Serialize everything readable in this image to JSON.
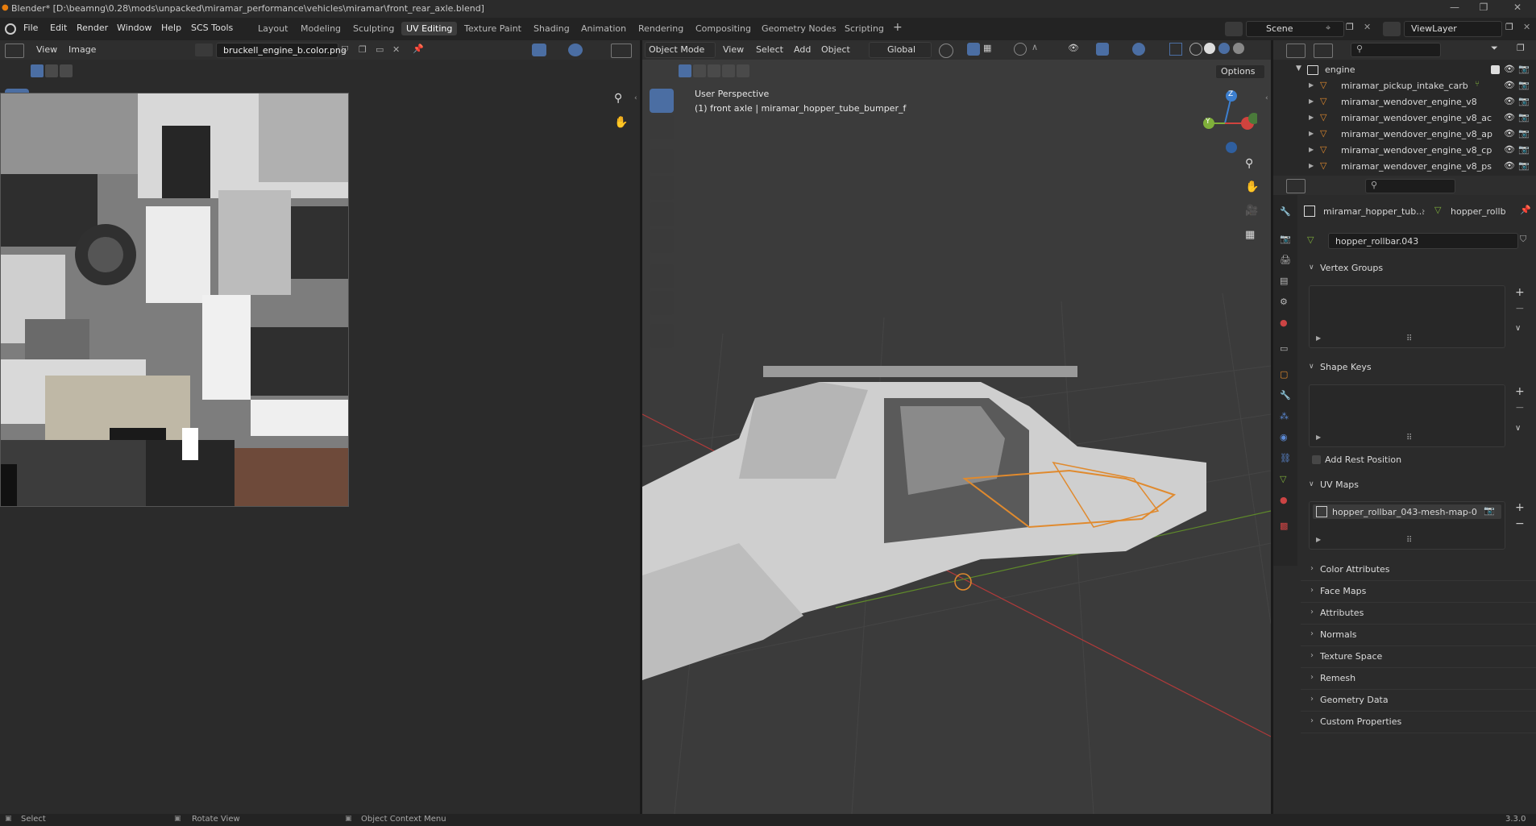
{
  "window": {
    "title": "Blender* [D:\\beamng\\0.28\\mods\\unpacked\\miramar_performance\\vehicles\\miramar\\front_rear_axle.blend]"
  },
  "menu": [
    "File",
    "Edit",
    "Render",
    "Window",
    "Help",
    "SCS Tools"
  ],
  "workspaces": [
    "Layout",
    "Modeling",
    "Sculpting",
    "UV Editing",
    "Texture Paint",
    "Shading",
    "Animation",
    "Rendering",
    "Compositing",
    "Geometry Nodes",
    "Scripting"
  ],
  "active_workspace": "UV Editing",
  "scene": "Scene",
  "view_layer": "ViewLayer",
  "uv_editor": {
    "view_label": "View",
    "image_label": "Image",
    "image_name": "bruckell_engine_b.color.png"
  },
  "viewport": {
    "mode": "Object Mode",
    "menus": [
      "View",
      "Select",
      "Add",
      "Object"
    ],
    "transform_orientation": "Global",
    "options": "Options",
    "overlay_line1": "User Perspective",
    "overlay_line2": "(1) front axle | miramar_hopper_tube_bumper_f",
    "gizmo_axes": {
      "z": "Z",
      "y": "Y"
    }
  },
  "outliner": {
    "collection": "engine",
    "items": [
      "miramar_pickup_intake_carb",
      "miramar_wendover_engine_v8",
      "miramar_wendover_engine_v8_ac",
      "miramar_wendover_engine_v8_ap",
      "miramar_wendover_engine_v8_cp",
      "miramar_wendover_engine_v8_ps"
    ]
  },
  "properties": {
    "breadcrumb_object": "miramar_hopper_tub...",
    "breadcrumb_mesh": "hopper_rollb",
    "mesh_name": "hopper_rollbar.043",
    "sections": {
      "vertex_groups": "Vertex Groups",
      "shape_keys": "Shape Keys",
      "add_rest_position": "Add Rest Position",
      "uv_maps": "UV Maps",
      "uv_map_item": "hopper_rollbar_043-mesh-map-0"
    },
    "collapsed": [
      "Color Attributes",
      "Face Maps",
      "Attributes",
      "Normals",
      "Texture Space",
      "Remesh",
      "Geometry Data",
      "Custom Properties"
    ]
  },
  "statusbar": {
    "select": "Select",
    "rotate": "Rotate View",
    "context": "Object Context Menu",
    "version": "3.3.0"
  },
  "colors": {
    "accent": "#4b6ea3",
    "active_orange": "#e08a2e",
    "axis_x": "#d0433e",
    "axis_y": "#7fb03a",
    "axis_z": "#3c7fcf"
  }
}
